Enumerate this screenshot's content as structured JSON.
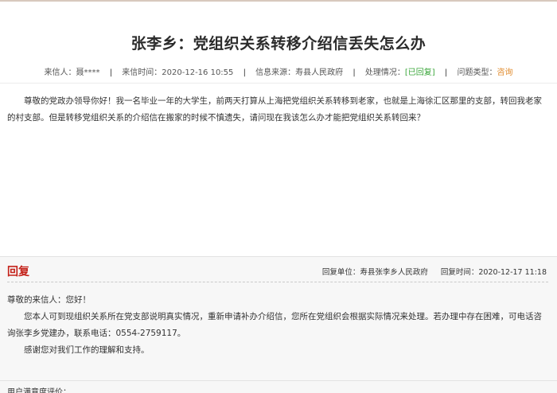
{
  "letter": {
    "title": "张李乡：党组织关系转移介绍信丢失怎么办",
    "meta": {
      "sender_label": "来信人：",
      "sender_value": "聂****",
      "time_label": "来信时间：",
      "time_value": "2020-12-16 10:55",
      "source_label": "信息来源：",
      "source_value": "寿县人民政府",
      "status_label": "处理情况：",
      "status_value": "[已回复]",
      "type_label": "问题类型：",
      "type_value": "咨询",
      "separator": "|"
    },
    "body": "尊敬的党政办领导你好！我一名毕业一年的大学生，前两天打算从上海把党组织关系转移到老家，也就是上海徐汇区那里的支部，转回我老家的村支部。但是转移党组织关系的介绍信在搬家的时候不慎遗失，请问现在我该怎么办才能把党组织关系转回来？"
  },
  "reply": {
    "heading": "回复",
    "unit_label": "回复单位：",
    "unit_value": "寿县张李乡人民政府",
    "time_label": "回复时间：",
    "time_value": "2020-12-17 11:18",
    "greeting": "尊敬的来信人：您好！",
    "paragraph1": "您本人可到现组织关系所在党支部说明真实情况，重新申请补办介绍信，您所在党组织会根据实际情况来处理。若办理中存在困难，可电话咨询张李乡党建办，联系电话：0554-2759117。",
    "paragraph2": "感谢您对我们工作的理解和支持。"
  },
  "satisfaction": {
    "label": "用户满意度评价："
  },
  "colors": {
    "reply_heading": "#c4221a",
    "status_replied": "#3aa63a",
    "type_consult": "#e08a2b"
  }
}
